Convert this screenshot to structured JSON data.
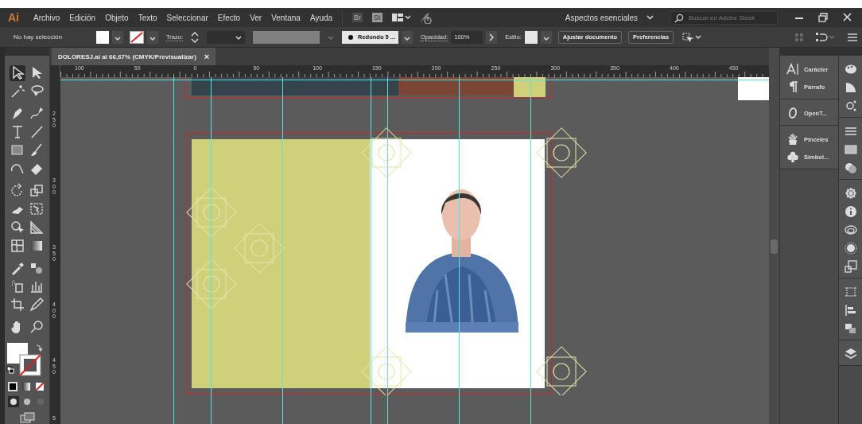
{
  "app": {
    "logo": "Ai",
    "menu": [
      "Archivo",
      "Edición",
      "Objeto",
      "Texto",
      "Seleccionar",
      "Efecto",
      "Ver",
      "Ventana",
      "Ayuda"
    ],
    "bridge": "Br",
    "stock": "St",
    "workspace": "Aspectos esenciales",
    "search": {
      "placeholder": "Buscar en Adobe Stock"
    }
  },
  "control_bar": {
    "selection": "No hay selección",
    "stroke_label": "Trazo:",
    "brush": "Redondo 5 ...",
    "opacity_label": "Opacidad:",
    "opacity": "100%",
    "style_label": "Estilo:",
    "buttons": [
      "Ajustar documento",
      "Preferencias"
    ]
  },
  "document_tab": {
    "title": "DOLORESJ.ai al 66,67% (CMYK/Previsualizar)",
    "close": "×"
  },
  "rulers": {
    "horizontal": [
      "100",
      "50",
      "0",
      "50",
      "100",
      "150",
      "200",
      "250",
      "300",
      "350",
      "400",
      "450"
    ],
    "vertical": [
      "250",
      "300",
      "350",
      "400",
      "450",
      "5"
    ]
  },
  "panels": [
    {
      "items": [
        {
          "label": "Carácter",
          "kind": "character"
        },
        {
          "label": "Párrafo",
          "kind": "paragraph"
        }
      ]
    },
    {
      "items": [
        {
          "label": "OpenT...",
          "kind": "opentype"
        }
      ]
    },
    {
      "items": [
        {
          "label": "Pinceles",
          "kind": "brushes"
        },
        {
          "label": "Símbol...",
          "kind": "symbols"
        }
      ]
    }
  ]
}
